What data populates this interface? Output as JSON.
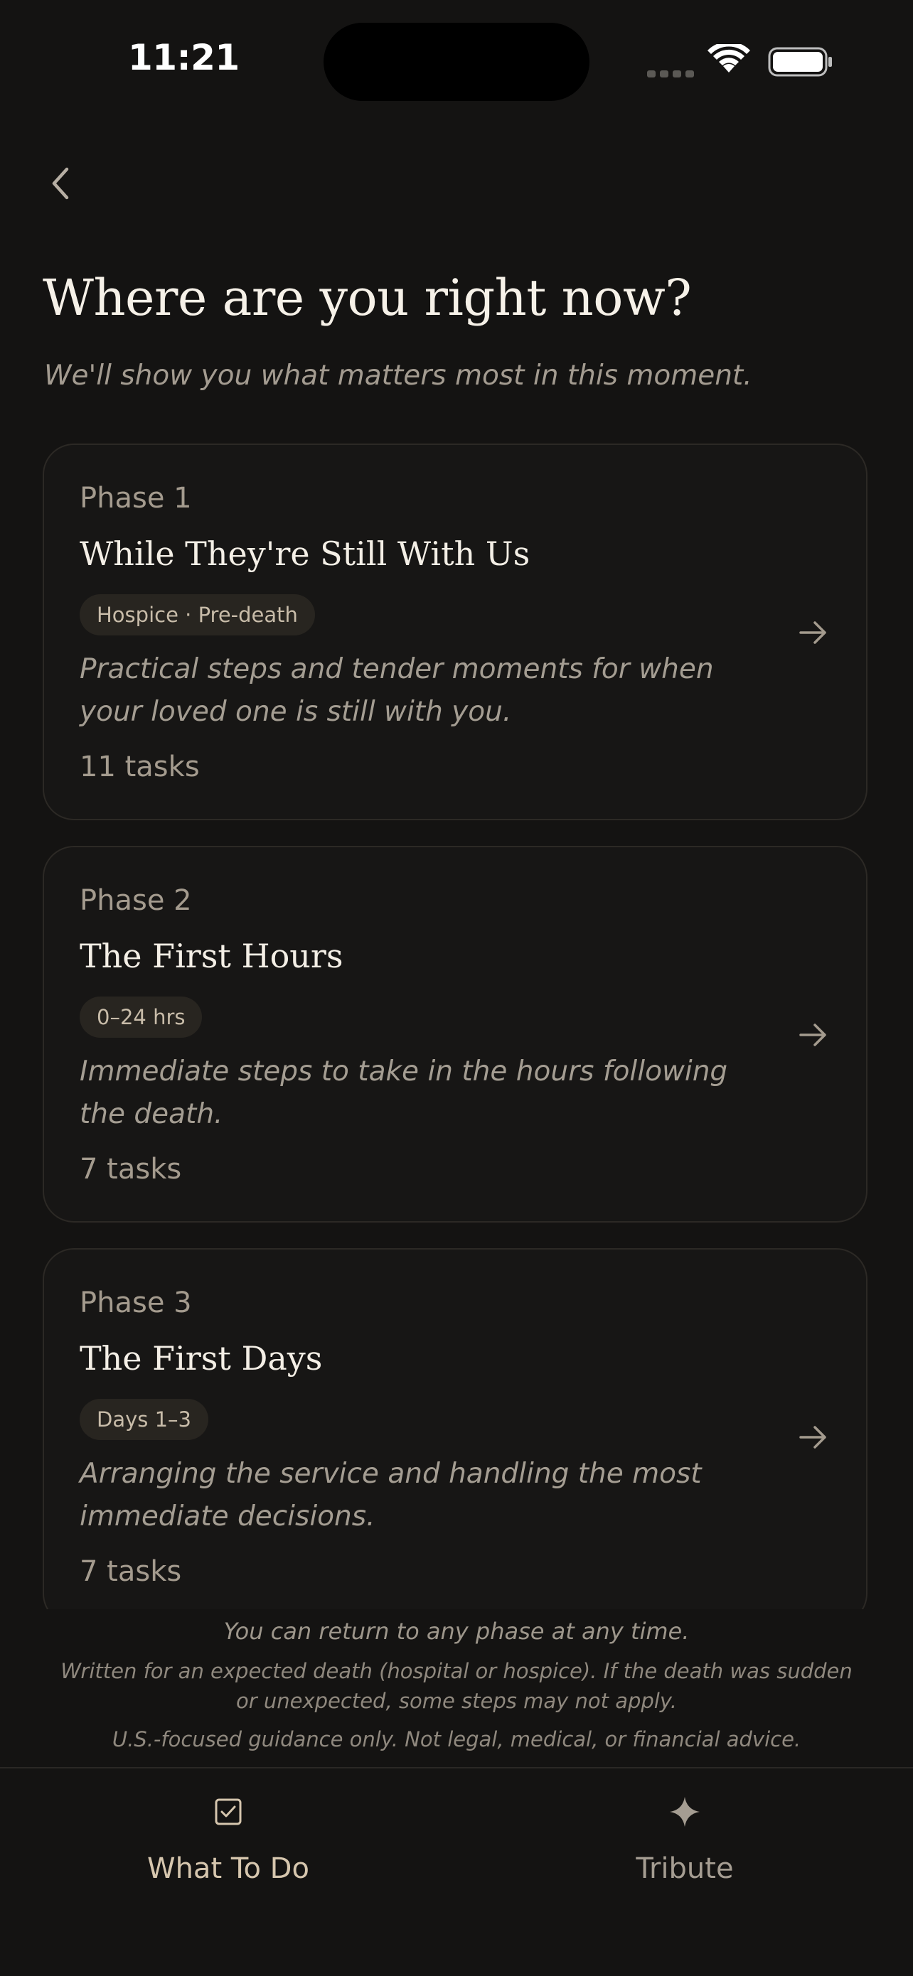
{
  "status_bar": {
    "time": "11:21"
  },
  "header": {
    "title": "Where are you right now?",
    "subtitle": "We'll show you what matters most in this moment."
  },
  "phases": [
    {
      "label": "Phase 1",
      "title": "While They're Still With Us",
      "badge": "Hospice · Pre-death",
      "description": "Practical steps and tender moments for when your loved one is still with you.",
      "task_count": "11 tasks"
    },
    {
      "label": "Phase 2",
      "title": "The First Hours",
      "badge": "0–24 hrs",
      "description": "Immediate steps to take in the hours following the death.",
      "task_count": "7 tasks"
    },
    {
      "label": "Phase 3",
      "title": "The First Days",
      "badge": "Days 1–3",
      "description": "Arranging the service and handling the most immediate decisions.",
      "task_count": "7 tasks"
    }
  ],
  "disclaimer": {
    "line1": "You can return to any phase at any time.",
    "line2": "Written for an expected death (hospital or hospice). If the death was sudden or unexpected, some steps may not apply.",
    "line3": "U.S.-focused guidance only. Not legal, medical, or financial advice."
  },
  "tab_bar": {
    "tabs": [
      {
        "label": "What To Do",
        "icon": "checkbox-icon",
        "active": true
      },
      {
        "label": "Tribute",
        "icon": "sparkle-icon",
        "active": false
      }
    ]
  },
  "colors": {
    "background": "#141312",
    "card": "#171615",
    "accent": "#d6c6ae",
    "muted": "#a49b8e"
  }
}
